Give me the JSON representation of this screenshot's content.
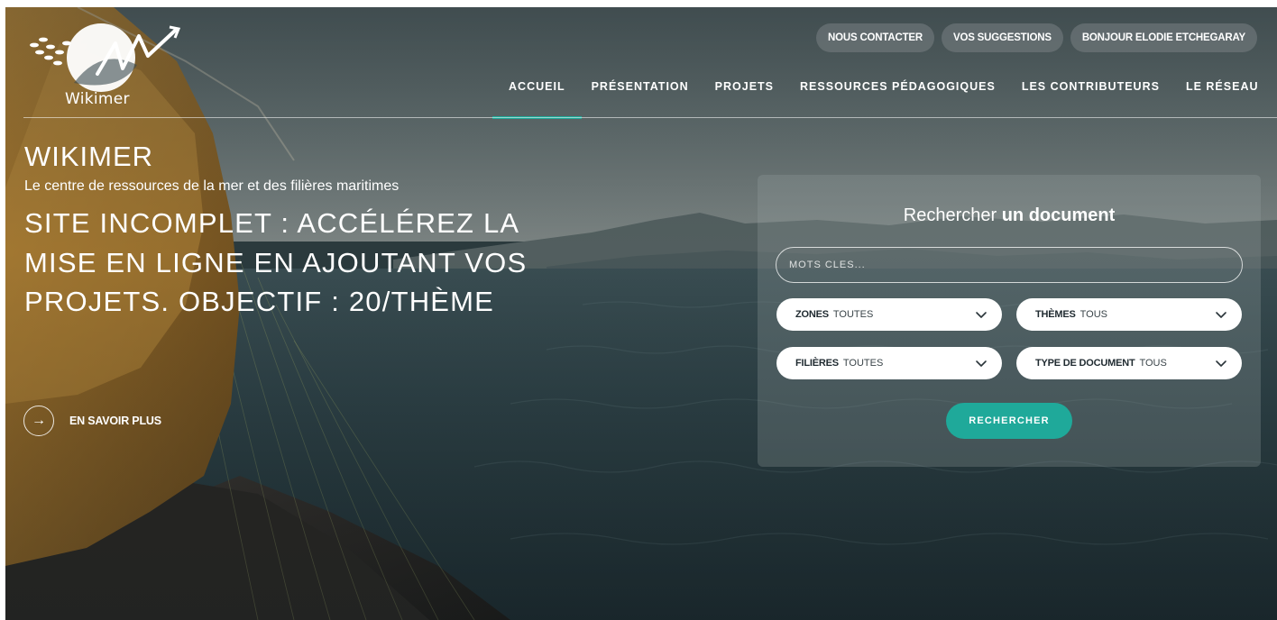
{
  "brand": {
    "logo_text": "Wikimer"
  },
  "top_links": [
    {
      "label": "NOUS CONTACTER"
    },
    {
      "label": "VOS SUGGESTIONS"
    },
    {
      "label": "BONJOUR ELODIE ETCHEGARAY"
    }
  ],
  "nav": {
    "items": [
      {
        "label": "ACCUEIL",
        "active": true
      },
      {
        "label": "PRÉSENTATION",
        "active": false
      },
      {
        "label": "PROJETS",
        "active": false
      },
      {
        "label": "RESSOURCES PÉDAGOGIQUES",
        "active": false
      },
      {
        "label": "LES CONTRIBUTEURS",
        "active": false
      },
      {
        "label": "LE RÉSEAU",
        "active": false
      }
    ]
  },
  "hero": {
    "title": "WIKIMER",
    "tagline": "Le centre de ressources de la mer et des filières maritimes",
    "headline": "SITE INCOMPLET : ACCÉLÉREZ LA MISE EN LIGNE EN AJOUTANT VOS PROJETS. OBJECTIF : 20/THÈME",
    "learn_more": "EN SAVOIR PLUS"
  },
  "search": {
    "title_prefix": "Rechercher",
    "title_bold": "un document",
    "keywords_placeholder": "MOTS CLES...",
    "filters": {
      "zones": {
        "label": "ZONES",
        "value": "TOUTES"
      },
      "themes": {
        "label": "THÈMES",
        "value": "TOUS"
      },
      "filieres": {
        "label": "FILIÈRES",
        "value": "TOUTES"
      },
      "type": {
        "label": "TYPE DE DOCUMENT",
        "value": "TOUS"
      }
    },
    "submit_label": "RECHERCHER"
  },
  "colors": {
    "accent": "#1fa99a",
    "pill_bg": "#78808499"
  }
}
